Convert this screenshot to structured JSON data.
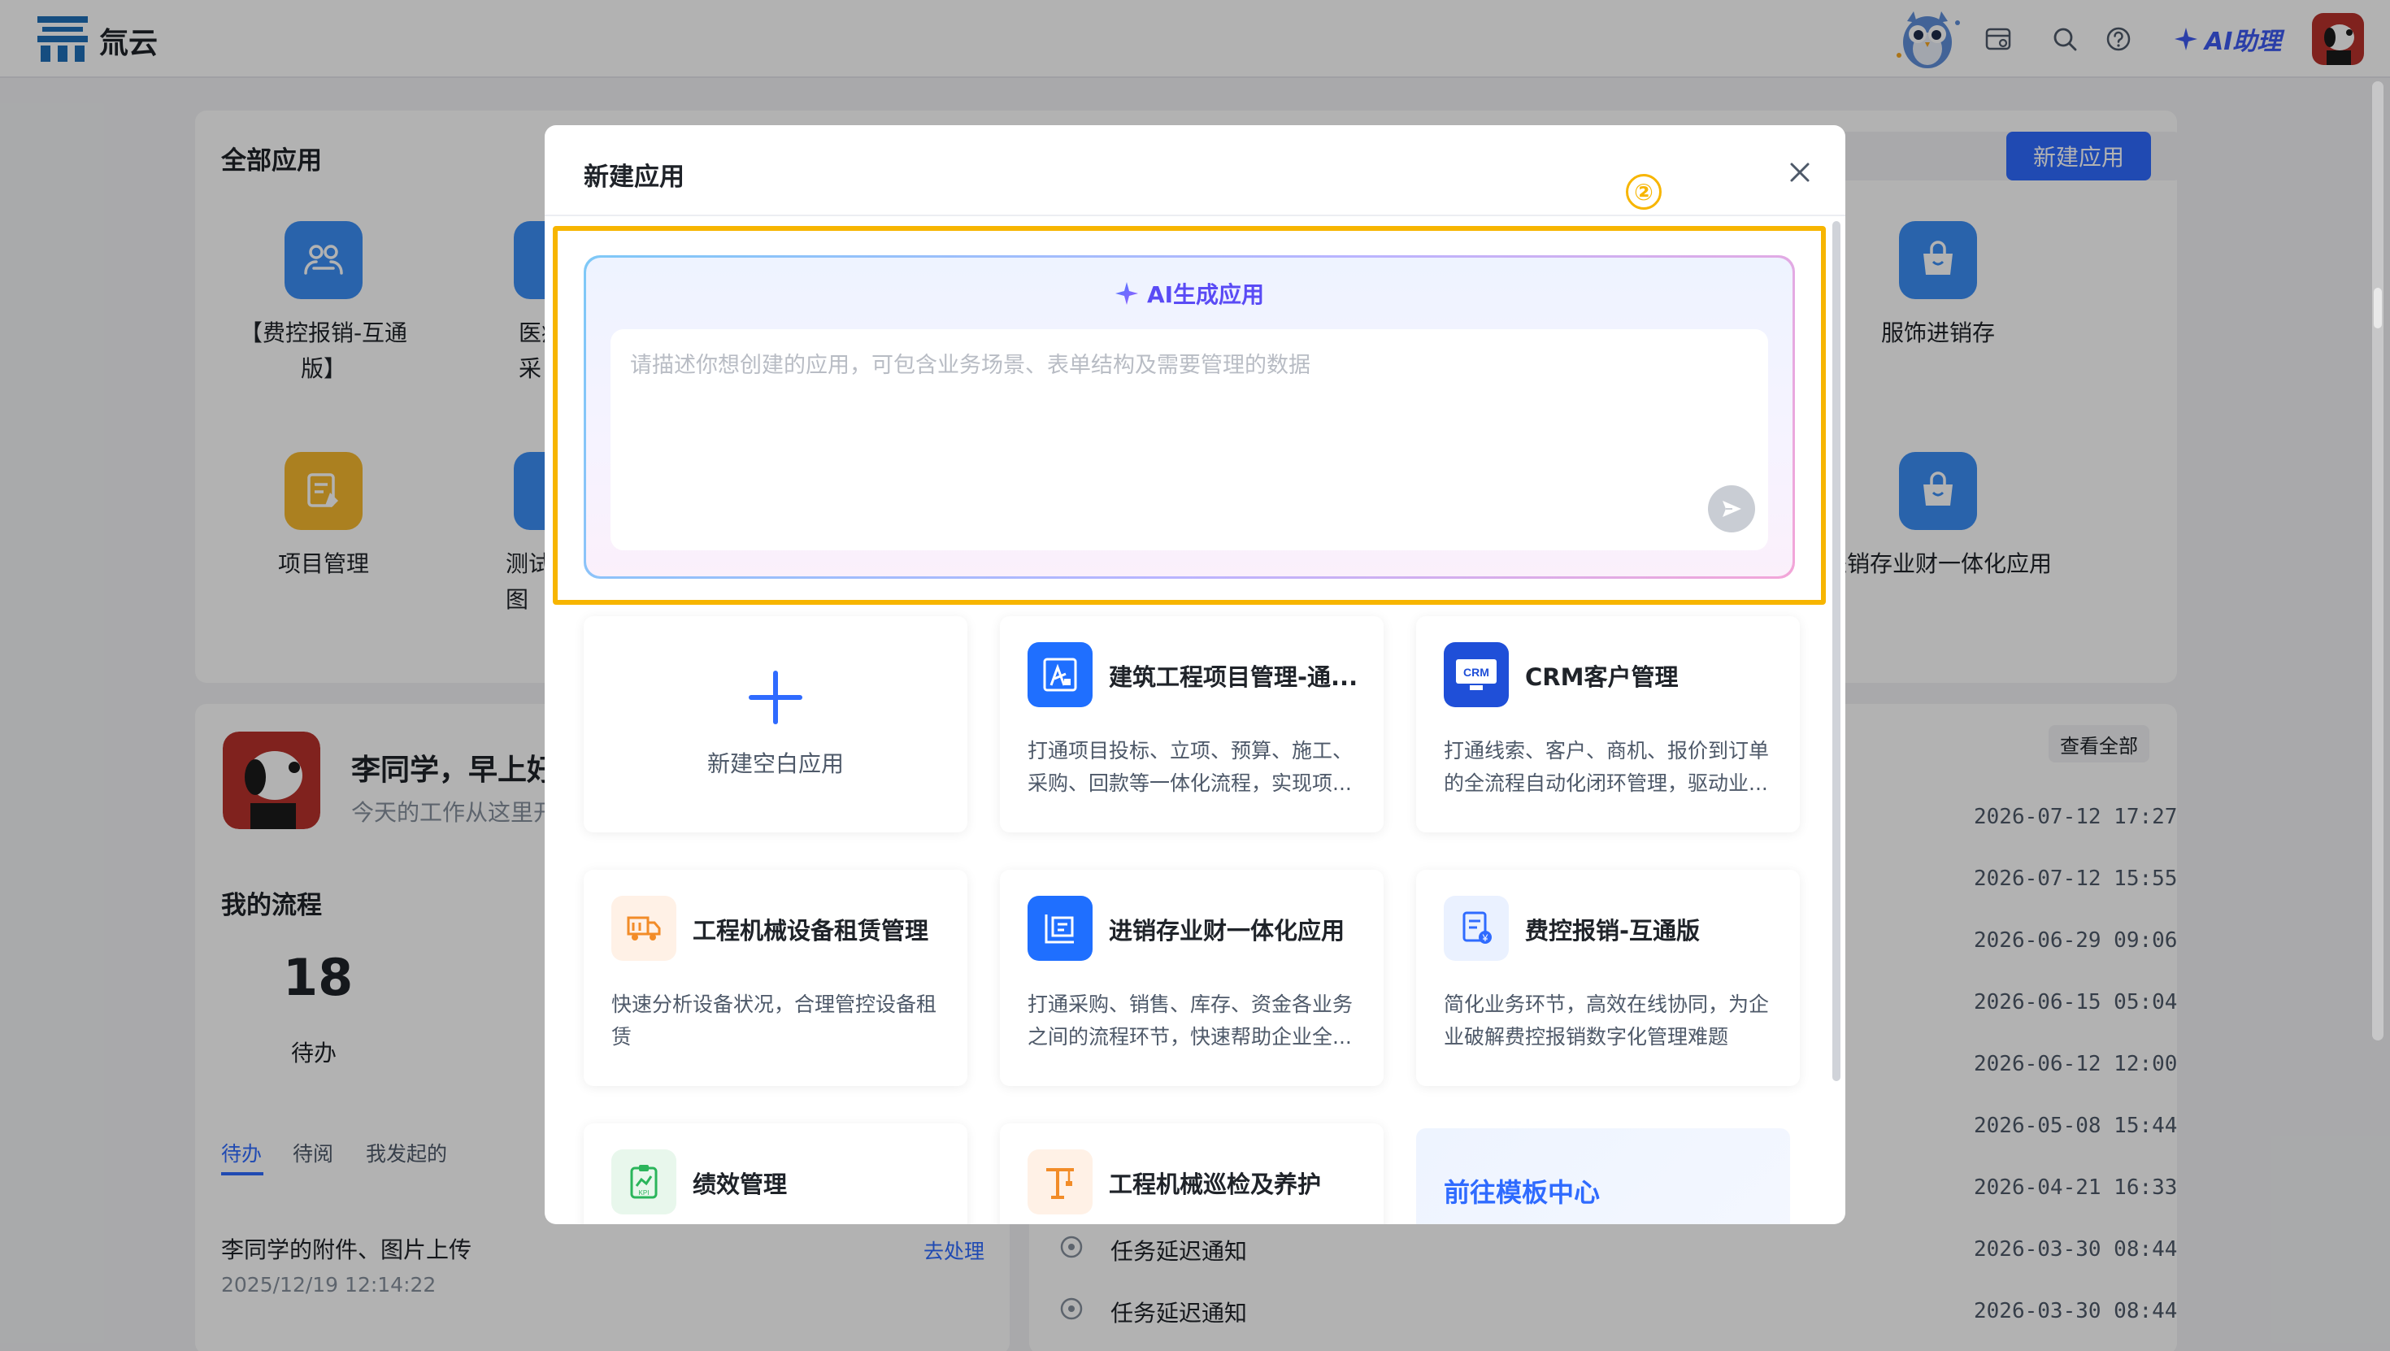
{
  "colors": {
    "primary": "#2f6bff",
    "ai_purple": "#5a4bf5",
    "highlight": "#f7b500",
    "app_blue": "#3b8ff5",
    "app_yellow": "#f5b82e"
  },
  "topbar": {
    "brand": "氚云",
    "ai_assistant": "AI助理",
    "icons": [
      "owl-mascot-icon",
      "calendar-icon",
      "search-icon",
      "help-icon",
      "sparkle-icon",
      "avatar"
    ]
  },
  "apps_section": {
    "title": "全部应用",
    "new_app_button": "新建应用",
    "apps": [
      {
        "name": "【费控报销-互通版】",
        "icon": "reimburse-icon",
        "color": "#3b8ff5"
      },
      {
        "name": "医疗采",
        "icon": "medical-icon",
        "color": "#3b8ff5"
      },
      {
        "name": "服饰进销存",
        "icon": "bag-icon",
        "color": "#3b8ff5"
      },
      {
        "name": "项目管理",
        "icon": "project-icon",
        "color": "#f5b82e"
      },
      {
        "name": "测试图",
        "icon": "chart-icon",
        "color": "#3b8ff5"
      },
      {
        "name": "进销存业财一体化应用",
        "icon": "bag-icon",
        "color": "#3b8ff5"
      }
    ]
  },
  "welcome": {
    "greeting": "李同学，早上好",
    "subtitle": "今天的工作从这里开始"
  },
  "workflow": {
    "title": "我的流程",
    "pending_count": "18",
    "pending_label": "待办",
    "tabs": [
      "待办",
      "待阅",
      "我发起的"
    ],
    "item_title": "李同学的附件、图片上传",
    "item_time": "2025/12/19 12:14:22",
    "item_action": "去处理"
  },
  "notifications": {
    "view_all": "查看全部",
    "items": [
      {
        "title": "",
        "time": "2026-07-12 17:27"
      },
      {
        "title": "",
        "time": "2026-07-12 15:55"
      },
      {
        "title": "",
        "time": "2026-06-29 09:06"
      },
      {
        "title": "",
        "time": "2026-06-15 05:04"
      },
      {
        "title": "",
        "time": "2026-06-12 12:00"
      },
      {
        "title": "",
        "time": "2026-05-08 15:44"
      },
      {
        "title": "",
        "time": "2026-04-21 16:33"
      },
      {
        "title": "任务延迟通知",
        "time": "2026-03-30 08:44"
      },
      {
        "title": "任务延迟通知",
        "time": "2026-03-30 08:44"
      }
    ]
  },
  "modal": {
    "title": "新建应用",
    "step_marker": "②",
    "ai": {
      "title": "AI生成应用",
      "placeholder": "请描述你想创建的应用，可包含业务场景、表单结构及需要管理的数据"
    },
    "blank_app": "新建空白应用",
    "templates": [
      {
        "name": "建筑工程项目管理-通...",
        "desc": "打通项目投标、立项、预算、施工、采购、回款等一体化流程，实现项...",
        "icon": "construction-icon",
        "color": "#1f6fff"
      },
      {
        "name": "CRM客户管理",
        "desc": "打通线索、客户、商机、报价到订单的全流程自动化闭环管理，驱动业...",
        "icon": "crm-icon",
        "color": "#1f4fd8"
      },
      {
        "name": "工程机械设备租赁管理",
        "desc": "快速分析设备状况，合理管控设备租赁",
        "icon": "truck-icon",
        "color": "#fff1e6"
      },
      {
        "name": "进销存业财一体化应用",
        "desc": "打通采购、销售、库存、资金各业务之间的流程环节，快速帮助企业全...",
        "icon": "inventory-icon",
        "color": "#1f6fff"
      },
      {
        "name": "费控报销-互通版",
        "desc": "简化业务环节，高效在线协同，为企业破解费控报销数字化管理难题",
        "icon": "reimburse-doc-icon",
        "color": "#eaf1ff"
      },
      {
        "name": "绩效管理",
        "desc": "",
        "icon": "kpi-icon",
        "color": "#e8f7ec"
      },
      {
        "name": "工程机械巡检及养护",
        "desc": "",
        "icon": "crane-icon",
        "color": "#fff1e6"
      }
    ],
    "goto_template_center": "前往模板中心"
  }
}
